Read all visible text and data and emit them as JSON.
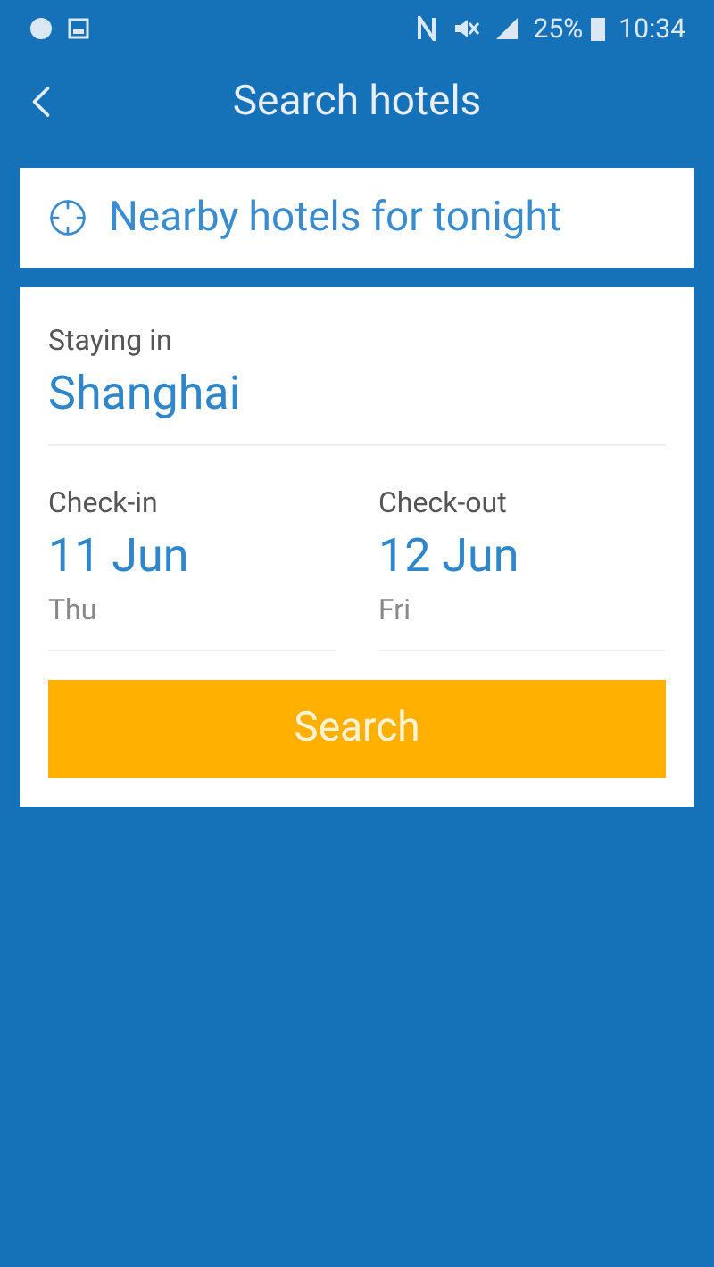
{
  "status_bar": {
    "battery": "25%",
    "time": "10:34"
  },
  "header": {
    "title": "Search hotels"
  },
  "nearby": {
    "label": "Nearby hotels for tonight"
  },
  "form": {
    "destination": {
      "label": "Staying in",
      "value": "Shanghai"
    },
    "dates": [
      {
        "label": "Check-in",
        "date": "11 Jun",
        "weekday": "Thu"
      },
      {
        "label": "Check-out",
        "date": "12 Jun",
        "weekday": "Fri"
      }
    ],
    "button": "Search"
  }
}
